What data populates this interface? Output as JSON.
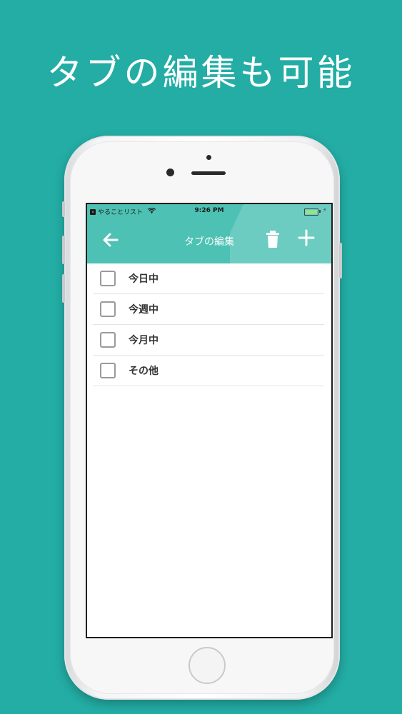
{
  "promo": {
    "headline": "タブの編集も可能"
  },
  "statusbar": {
    "back_app_label": "やることリスト",
    "time": "9:26 PM"
  },
  "appbar": {
    "title": "タブの編集",
    "back_icon": "arrow-left-icon",
    "trash_icon": "trash-icon",
    "add_icon": "plus-icon"
  },
  "tabs": [
    {
      "label": "今日中",
      "checked": false
    },
    {
      "label": "今週中",
      "checked": false
    },
    {
      "label": "今月中",
      "checked": false
    },
    {
      "label": "その他",
      "checked": false
    }
  ],
  "colors": {
    "background": "#23ada5",
    "appbar": "#4dc1b3",
    "text": "#333333"
  }
}
